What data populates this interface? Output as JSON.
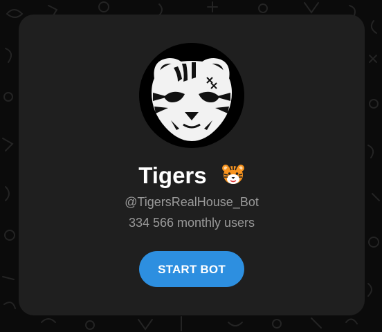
{
  "bot": {
    "name": "Tigers",
    "username": "@TigersRealHouse_Bot",
    "monthly_users": "334 566 monthly users",
    "emoji": "tiger-face-icon"
  },
  "actions": {
    "start_label": "START BOT"
  },
  "colors": {
    "page_bg": "#0b0b0b",
    "card_bg": "#1f1f1f",
    "button_bg": "#2d8fe0",
    "title_text": "#ffffff",
    "muted_text": "#9a9a9a"
  }
}
